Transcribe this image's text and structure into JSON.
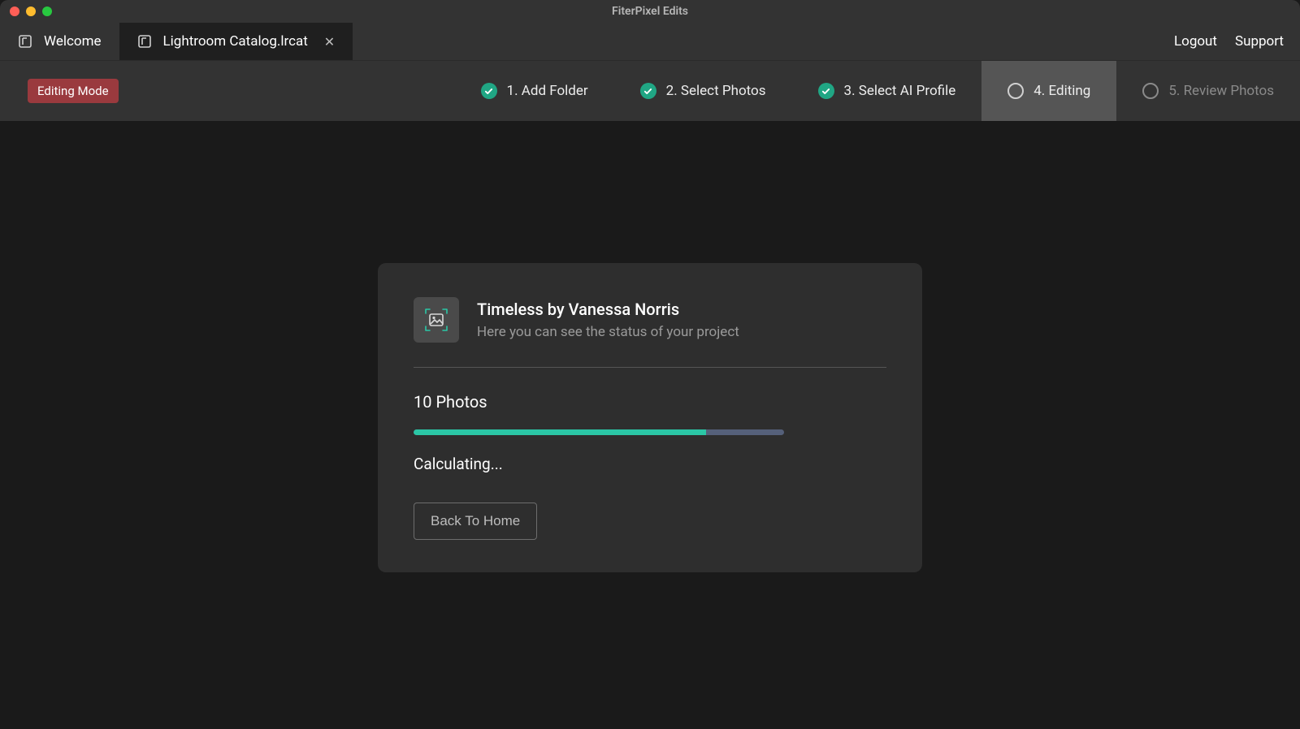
{
  "window": {
    "title": "FiterPixel Edits"
  },
  "tabs": {
    "items": [
      {
        "label": "Welcome",
        "active": false
      },
      {
        "label": "Lightroom Catalog.lrcat",
        "active": true
      }
    ]
  },
  "header_links": {
    "logout": "Logout",
    "support": "Support"
  },
  "badge": {
    "text": "Editing Mode"
  },
  "steps": {
    "items": [
      {
        "label": "1. Add Folder",
        "state": "done"
      },
      {
        "label": "2. Select Photos",
        "state": "done"
      },
      {
        "label": "3. Select AI Profile",
        "state": "done"
      },
      {
        "label": "4. Editing",
        "state": "current"
      },
      {
        "label": "5. Review Photos",
        "state": "future"
      }
    ]
  },
  "project": {
    "title": "Timeless by Vanessa Norris",
    "subtitle": "Here you can see the status of your project",
    "photos_label": "10 Photos",
    "status": "Calculating...",
    "progress_percent": 79
  },
  "buttons": {
    "back_home": "Back To Home"
  }
}
